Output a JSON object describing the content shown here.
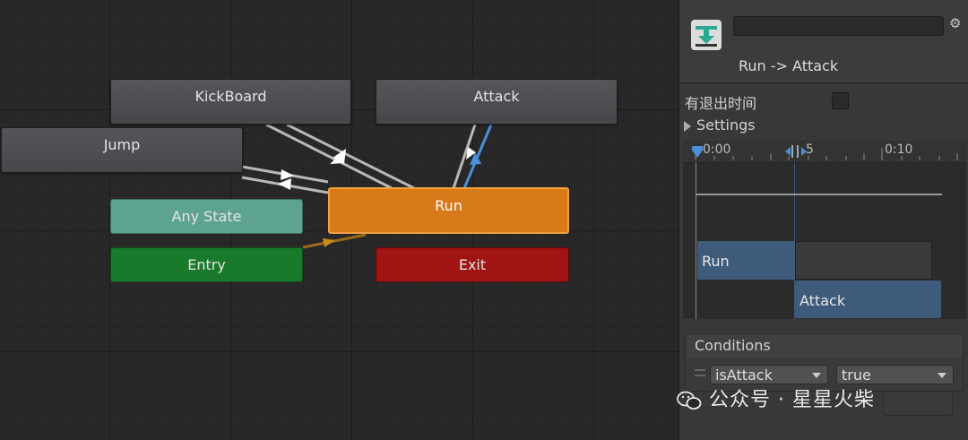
{
  "graph": {
    "nodes": {
      "kickboard": "KickBoard",
      "attack": "Attack",
      "jump": "Jump",
      "run": "Run",
      "any_state": "Any State",
      "entry": "Entry",
      "exit": "Exit"
    }
  },
  "inspector": {
    "transition_name_value": "",
    "transition_title": "Run -> Attack",
    "has_exit_time_label": "有退出时间",
    "has_exit_time_checked": false,
    "settings_label": "Settings",
    "timeline": {
      "tick_0": "0:00",
      "tick_5": "5",
      "tick_10": "0:10",
      "run_bar": "Run",
      "attack_bar": "Attack"
    },
    "conditions": {
      "header": "Conditions",
      "parameter": "isAttack",
      "value": "true"
    }
  },
  "watermark": "公众号 · 星星火柴",
  "colors": {
    "run_node": "#d97a1a",
    "any_state_node": "#5ea392",
    "entry_node": "#1a7a2c",
    "exit_node": "#a01414",
    "selected_transition": "#4a8fd8",
    "timeline_bar": "#3f5b7c"
  }
}
